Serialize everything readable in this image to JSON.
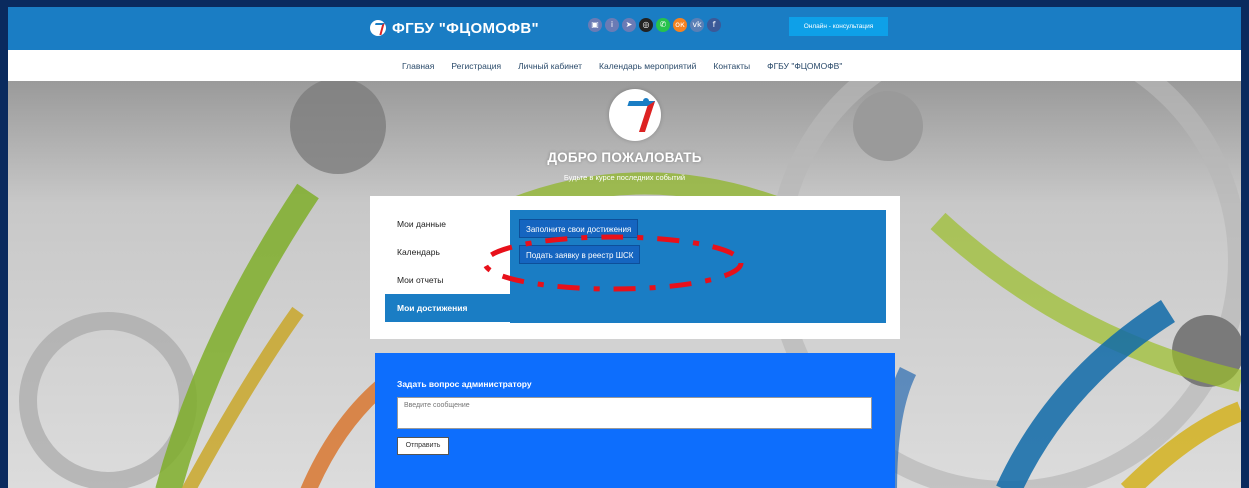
{
  "header": {
    "brand": "ФГБУ \"ФЦОМОФВ\"",
    "consult_button": "Онлайн - консультация",
    "socials": [
      {
        "icon": "contact-card-icon",
        "glyph": "▣",
        "color": "#6a7bb5"
      },
      {
        "icon": "person-icon",
        "glyph": "i",
        "color": "#6a7bb5"
      },
      {
        "icon": "telegram-icon",
        "glyph": "➤",
        "color": "#6a7bb5"
      },
      {
        "icon": "instagram-icon",
        "glyph": "◎",
        "color": "#222222"
      },
      {
        "icon": "whatsapp-icon",
        "glyph": "✆",
        "color": "#27c24c"
      },
      {
        "icon": "odnoklassniki-icon",
        "glyph": "ок",
        "color": "#f58220"
      },
      {
        "icon": "vk-icon",
        "glyph": "vk",
        "color": "#5a7fb5"
      },
      {
        "icon": "facebook-icon",
        "glyph": "f",
        "color": "#3b5998"
      }
    ]
  },
  "nav": {
    "links": [
      "Главная",
      "Регистрация",
      "Личный кабинет",
      "Календарь мероприятий",
      "Контакты",
      "ФГБУ \"ФЦОМОФВ\""
    ]
  },
  "hero": {
    "title": "ДОБРО ПОЖАЛОВАТЬ",
    "tagline": "Будьте в курсе последних событий"
  },
  "profile": {
    "menu": [
      "Мои данные",
      "Календарь",
      "Мои отчеты",
      "Мои достижения"
    ],
    "active_index": 3,
    "panel_buttons": [
      "Заполните свои достижения",
      "Подать заявку в реестр ШСК"
    ]
  },
  "question": {
    "title": "Задать вопрос администратору",
    "placeholder": "Введите сообщение",
    "send_label": "Отправить"
  }
}
